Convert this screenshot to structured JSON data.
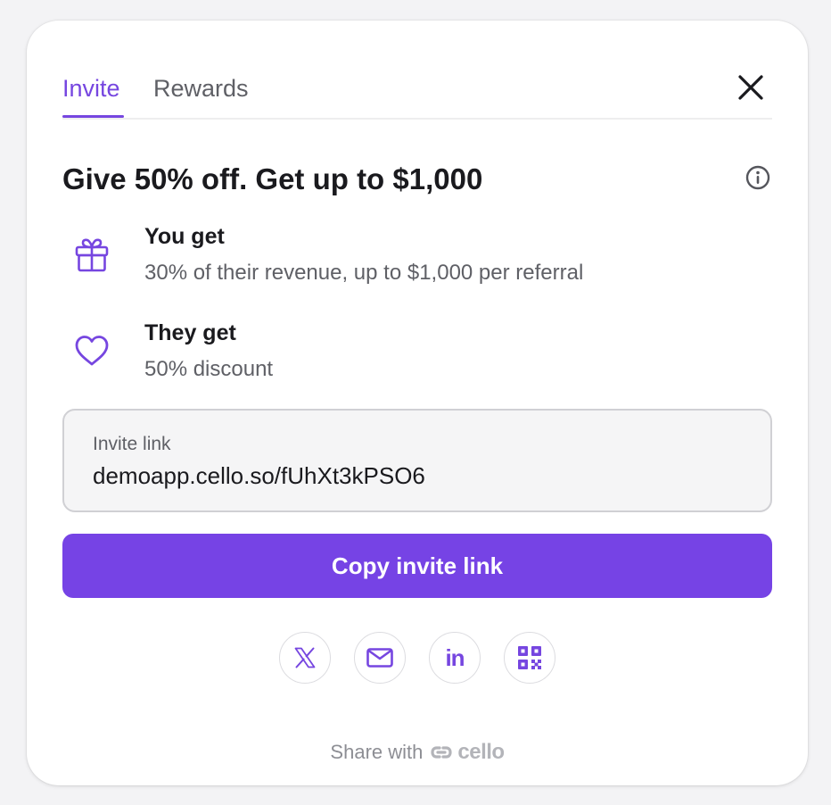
{
  "tabs": [
    {
      "label": "Invite",
      "active": true
    },
    {
      "label": "Rewards",
      "active": false
    }
  ],
  "headline": "Give 50% off. Get up to $1,000",
  "benefits": {
    "you": {
      "title": "You get",
      "desc": "30% of their revenue, up to $1,000 per referral",
      "icon": "gift-icon"
    },
    "they": {
      "title": "They get",
      "desc": "50% discount",
      "icon": "heart-icon"
    }
  },
  "invite_link": {
    "label": "Invite link",
    "value": "demoapp.cello.so/fUhXt3kPSO6"
  },
  "copy_button": "Copy invite link",
  "share_options": [
    "x-icon",
    "mail-icon",
    "linkedin-icon",
    "qr-code-icon"
  ],
  "linkedin_glyph": "in",
  "footer": {
    "text": "Share with",
    "brand": "cello"
  },
  "colors": {
    "accent": "#7646e0",
    "button": "#7643e5",
    "text_primary": "#1a1a1e",
    "text_secondary": "#5f6066"
  }
}
